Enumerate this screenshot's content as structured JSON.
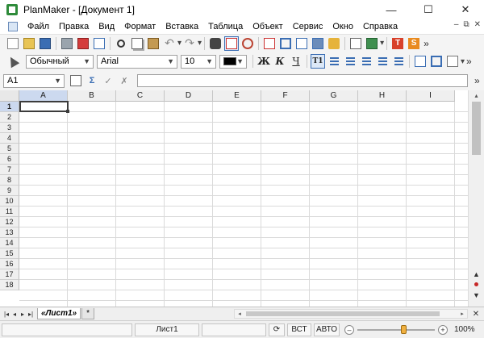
{
  "window": {
    "title": "PlanMaker - [Документ 1]",
    "controls": {
      "minimize": "—",
      "maximize": "☐",
      "close": "✕"
    }
  },
  "menu": {
    "items": [
      "Файл",
      "Правка",
      "Вид",
      "Формат",
      "Вставка",
      "Таблица",
      "Объект",
      "Сервис",
      "Окно",
      "Справка"
    ],
    "mdi": {
      "minimize": "–",
      "restore": "⧉",
      "close": "✕"
    }
  },
  "toolbar_standard": {
    "icons": [
      "new-document-icon",
      "open-icon",
      "save-icon",
      "print-icon",
      "export-pdf-icon",
      "print-preview-icon",
      "cut-icon",
      "copy-icon",
      "paste-icon",
      "undo-icon",
      "redo-icon",
      "find-icon",
      "insert-chart-icon",
      "zoom-icon",
      "text-frame-icon",
      "crop-icon",
      "borders-icon",
      "shading-icon",
      "format-painter-icon",
      "column-width-icon",
      "sort-icon",
      "textmaker-icon",
      "presentations-icon"
    ],
    "undo_glyph": "↶",
    "redo_glyph": "↷",
    "dropdown_glyph": "▾",
    "more_glyph": "»",
    "textmaker_label": "T",
    "presentations_label": "S"
  },
  "toolbar_format": {
    "style_value": "Обычный",
    "font_value": "Arial",
    "size_value": "10",
    "font_color": "#000000",
    "bold_label": "Ж",
    "italic_label": "К",
    "underline_label": "Ч",
    "text_frame_label": "T1",
    "more_glyph": "»"
  },
  "toolbar_formula": {
    "cell_ref": "A1",
    "formula_value": "",
    "more_glyph": "»"
  },
  "sheet": {
    "columns": [
      "A",
      "B",
      "C",
      "D",
      "E",
      "F",
      "G",
      "H",
      "I"
    ],
    "rows": [
      "1",
      "2",
      "3",
      "4",
      "5",
      "6",
      "7",
      "8",
      "9",
      "10",
      "11",
      "12",
      "13",
      "14",
      "15",
      "16",
      "17",
      "18"
    ],
    "active_column": "A",
    "active_row": "1"
  },
  "tabs": {
    "nav": [
      "|◂",
      "◂",
      "▸",
      "▸|"
    ],
    "sheet_name": "«Лист1»",
    "add_label": "*",
    "scroll_left": "◂",
    "scroll_right": "▸",
    "corner": "✕"
  },
  "vertical_nav": {
    "up": "▴",
    "prev": "▲",
    "next": "▼"
  },
  "status": {
    "sheet": "Лист1",
    "insert_mode": "ВСТ",
    "calc_mode": "АВТО",
    "zoom": "100%",
    "zoom_fraction": 0.6,
    "zoom_minus": "–",
    "zoom_plus": "+"
  },
  "colors": {
    "active_header": "#ccd9ef",
    "grid_line": "#dadada",
    "toolbar_bg": "#f4f4f4"
  }
}
